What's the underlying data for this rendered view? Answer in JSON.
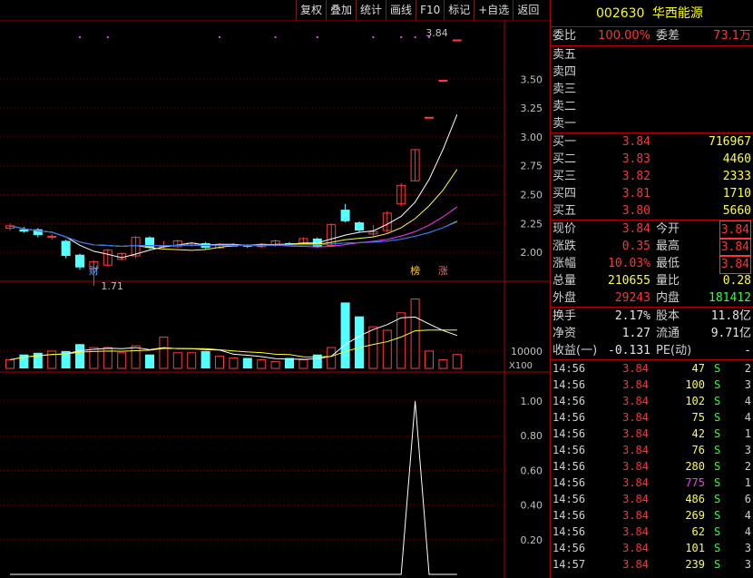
{
  "toolbar": [
    "复权",
    "叠加",
    "统计",
    "画线",
    "F10",
    "标记",
    "+自选",
    "返回"
  ],
  "stock": {
    "code": "002630",
    "name": "华西能源"
  },
  "quote": {
    "weibi_label": "委比",
    "weibi": "100.00%",
    "weicha_label": "委差",
    "weicha": "73.1万"
  },
  "sell_book": [
    "卖五",
    "卖四",
    "卖三",
    "卖二",
    "卖一"
  ],
  "buy_book": [
    {
      "label": "买一",
      "price": "3.84",
      "vol": "716967"
    },
    {
      "label": "买二",
      "price": "3.83",
      "vol": "4460"
    },
    {
      "label": "买三",
      "price": "3.82",
      "vol": "2333"
    },
    {
      "label": "买四",
      "price": "3.81",
      "vol": "1710"
    },
    {
      "label": "买五",
      "price": "3.80",
      "vol": "5660"
    }
  ],
  "stats": [
    {
      "l1": "现价",
      "v1": "3.84",
      "l2": "今开",
      "v2": "3.84"
    },
    {
      "l1": "涨跌",
      "v1": "0.35",
      "l2": "最高",
      "v2": "3.84"
    },
    {
      "l1": "涨幅",
      "v1": "10.03%",
      "l2": "最低",
      "v2": "3.84"
    },
    {
      "l1": "总量",
      "v1": "210655",
      "l2": "量比",
      "v2": "0.28"
    },
    {
      "l1": "外盘",
      "v1": "29243",
      "l2": "内盘",
      "v2": "181412"
    }
  ],
  "stats2": [
    {
      "l1": "换手",
      "v1": "2.17%",
      "l2": "股本",
      "v2": "11.8亿"
    },
    {
      "l1": "净资",
      "v1": "1.27",
      "l2": "流通",
      "v2": "9.71亿"
    },
    {
      "l1": "收益(一)",
      "v1": "-0.131",
      "l2": "PE(动)",
      "v2": "-"
    }
  ],
  "ticks": [
    {
      "time": "14:56",
      "price": "3.84",
      "vol": "47",
      "bs": "S",
      "n": "2"
    },
    {
      "time": "14:56",
      "price": "3.84",
      "vol": "100",
      "bs": "S",
      "n": "3"
    },
    {
      "time": "14:56",
      "price": "3.84",
      "vol": "102",
      "bs": "S",
      "n": "4"
    },
    {
      "time": "14:56",
      "price": "3.84",
      "vol": "75",
      "bs": "S",
      "n": "4"
    },
    {
      "time": "14:56",
      "price": "3.84",
      "vol": "42",
      "bs": "S",
      "n": "1"
    },
    {
      "time": "14:56",
      "price": "3.84",
      "vol": "76",
      "bs": "S",
      "n": "3"
    },
    {
      "time": "14:56",
      "price": "3.84",
      "vol": "280",
      "bs": "S",
      "n": "2"
    },
    {
      "time": "14:56",
      "price": "3.84",
      "vol": "775",
      "bs": "S",
      "n": "1"
    },
    {
      "time": "14:56",
      "price": "3.84",
      "vol": "486",
      "bs": "S",
      "n": "6"
    },
    {
      "time": "14:56",
      "price": "3.84",
      "vol": "269",
      "bs": "S",
      "n": "4"
    },
    {
      "time": "14:56",
      "price": "3.84",
      "vol": "62",
      "bs": "S",
      "n": "4"
    },
    {
      "time": "14:56",
      "price": "3.84",
      "vol": "101",
      "bs": "S",
      "n": "3"
    },
    {
      "time": "14:57",
      "price": "3.84",
      "vol": "239",
      "bs": "S",
      "n": "3"
    }
  ],
  "chart_data": {
    "type": "candlestick",
    "price_axis_ticks": [
      "3.50",
      "3.25",
      "3.00",
      "2.75",
      "2.50",
      "2.25",
      "2.00"
    ],
    "price_ylim": [
      1.75,
      3.95
    ],
    "top_label": "3.84",
    "low_label": "1.71",
    "markers": {
      "cai": "财",
      "bang": "榜",
      "zhang": "涨"
    },
    "volume_axis": {
      "tick": "10000",
      "unit": "X100"
    },
    "indicator_axis_ticks": [
      "1.00",
      "0.80",
      "0.60",
      "0.40",
      "0.20"
    ],
    "candles": [
      {
        "o": 2.21,
        "c": 2.23,
        "h": 2.25,
        "l": 2.19
      },
      {
        "o": 2.2,
        "c": 2.18,
        "h": 2.22,
        "l": 2.17
      },
      {
        "o": 2.2,
        "c": 2.15,
        "h": 2.21,
        "l": 2.13
      },
      {
        "o": 2.14,
        "c": 2.14,
        "h": 2.16,
        "l": 2.11
      },
      {
        "o": 2.1,
        "c": 1.97,
        "h": 2.11,
        "l": 1.95
      },
      {
        "o": 1.98,
        "c": 1.87,
        "h": 1.99,
        "l": 1.85
      },
      {
        "o": 1.86,
        "c": 1.92,
        "h": 1.93,
        "l": 1.71
      },
      {
        "o": 1.89,
        "c": 2.02,
        "h": 2.03,
        "l": 1.88
      },
      {
        "o": 1.94,
        "c": 1.99,
        "h": 2.0,
        "l": 1.93
      },
      {
        "o": 1.97,
        "c": 2.13,
        "h": 2.14,
        "l": 1.95
      },
      {
        "o": 2.13,
        "c": 2.04,
        "h": 2.14,
        "l": 2.03
      },
      {
        "o": 2.05,
        "c": 2.06,
        "h": 2.1,
        "l": 2.03
      },
      {
        "o": 2.05,
        "c": 2.1,
        "h": 2.11,
        "l": 2.04
      },
      {
        "o": 2.06,
        "c": 2.08,
        "h": 2.09,
        "l": 2.05
      },
      {
        "o": 2.08,
        "c": 2.04,
        "h": 2.09,
        "l": 2.03
      },
      {
        "o": 2.04,
        "c": 2.07,
        "h": 2.08,
        "l": 2.03
      },
      {
        "o": 2.06,
        "c": 2.06,
        "h": 2.08,
        "l": 2.05
      },
      {
        "o": 2.06,
        "c": 2.05,
        "h": 2.07,
        "l": 2.04
      },
      {
        "o": 2.05,
        "c": 2.07,
        "h": 2.08,
        "l": 2.04
      },
      {
        "o": 2.06,
        "c": 2.1,
        "h": 2.11,
        "l": 2.05
      },
      {
        "o": 2.08,
        "c": 2.07,
        "h": 2.09,
        "l": 2.06
      },
      {
        "o": 2.08,
        "c": 2.12,
        "h": 2.13,
        "l": 2.07
      },
      {
        "o": 2.12,
        "c": 2.05,
        "h": 2.13,
        "l": 2.04
      },
      {
        "o": 2.06,
        "c": 2.24,
        "h": 2.25,
        "l": 2.05
      },
      {
        "o": 2.37,
        "c": 2.27,
        "h": 2.42,
        "l": 2.26
      },
      {
        "o": 2.26,
        "c": 2.19,
        "h": 2.27,
        "l": 2.17
      },
      {
        "o": 2.16,
        "c": 2.18,
        "h": 2.24,
        "l": 2.14
      },
      {
        "o": 2.19,
        "c": 2.34,
        "h": 2.36,
        "l": 2.17
      },
      {
        "o": 2.42,
        "c": 2.58,
        "h": 2.6,
        "l": 2.4
      },
      {
        "o": 2.62,
        "c": 2.89,
        "h": 2.89,
        "l": 2.62
      },
      {
        "o": 3.17,
        "c": 3.17,
        "h": 3.17,
        "l": 3.17
      },
      {
        "o": 3.49,
        "c": 3.49,
        "h": 3.49,
        "l": 3.49
      },
      {
        "o": 3.84,
        "c": 3.84,
        "h": 3.84,
        "l": 3.84
      }
    ],
    "volumes": [
      5,
      8,
      9,
      10,
      10,
      14,
      12,
      12,
      9,
      13,
      8,
      18,
      9,
      9,
      10,
      7,
      6,
      6,
      5,
      4,
      6,
      5,
      8,
      12,
      38,
      30,
      24,
      22,
      32,
      40,
      10,
      5,
      8
    ],
    "indicator": [
      0,
      0,
      0,
      0,
      0,
      0,
      0,
      0,
      0,
      0,
      0,
      0,
      0,
      0,
      0,
      0,
      0,
      0,
      0,
      0,
      0,
      0,
      0,
      0,
      0,
      0,
      0,
      0,
      0,
      1,
      0,
      0,
      0
    ]
  }
}
